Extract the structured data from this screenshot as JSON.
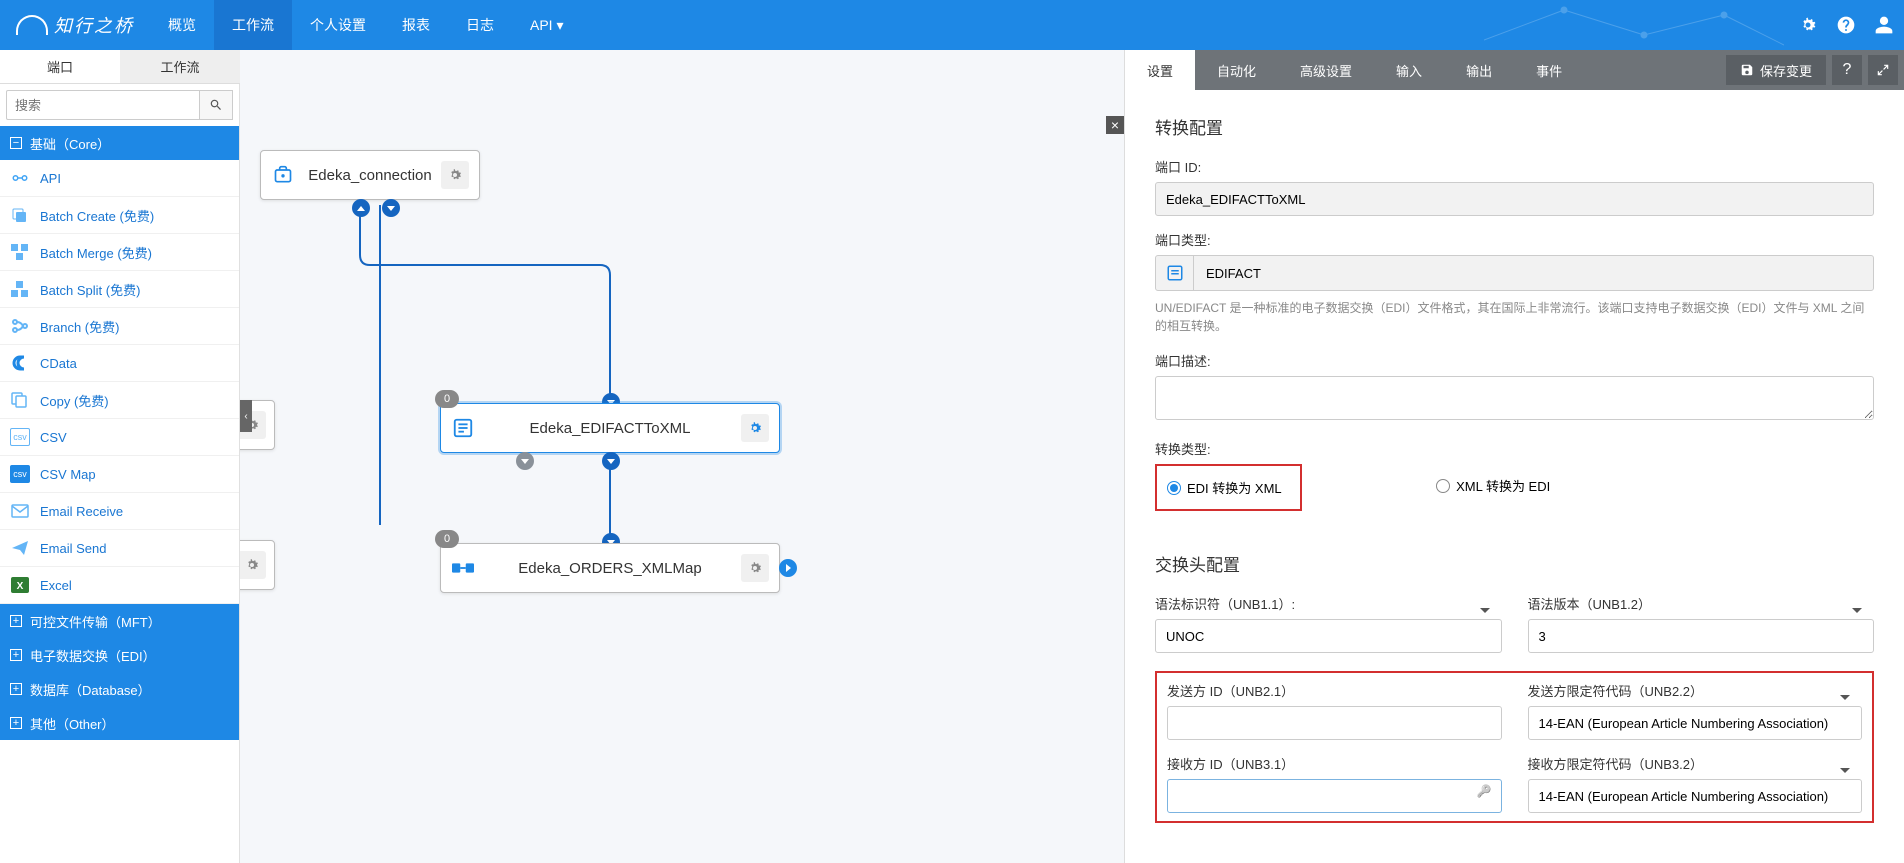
{
  "topnav": {
    "logo": "知行之桥",
    "items": [
      "概览",
      "工作流",
      "个人设置",
      "报表",
      "日志",
      "API ▾"
    ],
    "active_index": 1
  },
  "subtabs": {
    "items": [
      "端口",
      "工作流"
    ],
    "active_index": 0
  },
  "search": {
    "placeholder": "搜索"
  },
  "categories": [
    {
      "label": "基础（Core）",
      "expanded": true,
      "ports": [
        "API",
        "Batch Create (免费)",
        "Batch Merge (免费)",
        "Batch Split (免费)",
        "Branch (免费)",
        "CData",
        "Copy (免费)",
        "CSV",
        "CSV Map",
        "Email Receive",
        "Email Send",
        "Excel"
      ]
    },
    {
      "label": "可控文件传输（MFT）",
      "expanded": false
    },
    {
      "label": "电子数据交换（EDI）",
      "expanded": false
    },
    {
      "label": "数据库（Database）",
      "expanded": false
    },
    {
      "label": "其他（Other）",
      "expanded": false
    }
  ],
  "nodes": {
    "n1": {
      "label": "Edeka_connection"
    },
    "n2": {
      "label": "Edeka_EDIFACTToXML",
      "badge": "0"
    },
    "n3": {
      "label": "Edeka_ORDERS_XMLMap",
      "badge": "0"
    }
  },
  "panel": {
    "tabs": [
      "设置",
      "自动化",
      "高级设置",
      "输入",
      "输出",
      "事件"
    ],
    "active_tab": 0,
    "save": "保存变更",
    "section1": "转换配置",
    "port_id_label": "端口 ID:",
    "port_id": "Edeka_EDIFACTToXML",
    "port_type_label": "端口类型:",
    "port_type": "EDIFACT",
    "port_type_help": "UN/EDIFACT 是一种标准的电子数据交换（EDI）文件格式，其在国际上非常流行。该端口支持电子数据交换（EDI）文件与 XML 之间的相互转换。",
    "port_desc_label": "端口描述:",
    "trans_type_label": "转换类型:",
    "trans_opt1": "EDI 转换为 XML",
    "trans_opt2": "XML 转换为 EDI",
    "section2": "交换头配置",
    "unb11_label": "语法标识符（UNB1.1）:",
    "unb11": "UNOC",
    "unb12_label": "语法版本（UNB1.2）",
    "unb12": "3",
    "unb21_label": "发送方 ID（UNB2.1）",
    "unb22_label": "发送方限定符代码（UNB2.2）",
    "unb22": "14-EAN (European Article Numbering Association)",
    "unb31_label": "接收方 ID（UNB3.1）",
    "unb32_label": "接收方限定符代码（UNB3.2）",
    "unb32": "14-EAN (European Article Numbering Association)"
  }
}
